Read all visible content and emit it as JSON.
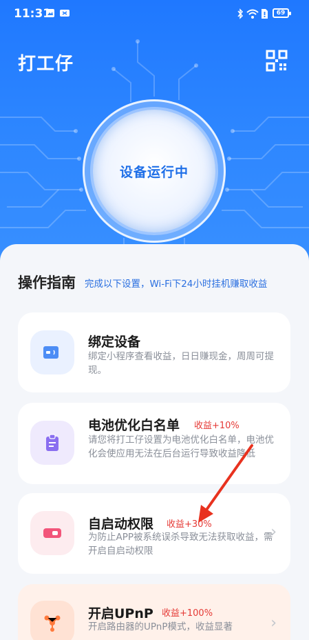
{
  "statusbar": {
    "time": "11:31",
    "battery": "69"
  },
  "header": {
    "title": "打工仔"
  },
  "hero": {
    "status_label": "设备运行中"
  },
  "guide": {
    "title": "操作指南",
    "subtitle": "完成以下设置，Wi-Fi下24小时挂机赚取收益"
  },
  "cards": [
    {
      "title": "绑定设备",
      "badge": "",
      "desc": "绑定小程序查看收益，日日赚现金，周周可提现。",
      "icon": "card-icon"
    },
    {
      "title": "电池优化白名单",
      "badge": "收益+10%",
      "desc": "请您将打工仔设置为电池优化白名单，电池优化会使应用无法在后台运行导致收益降低",
      "icon": "clipboard-icon"
    },
    {
      "title": "自启动权限",
      "badge": "收益+30%",
      "desc": "为防止APP被系统误杀导致无法获取收益，需开启自启动权限",
      "icon": "toggle-icon"
    },
    {
      "title": "开启UPnP",
      "badge": "收益+100%",
      "desc": "开启路由器的UPnP模式，收益显著",
      "icon": "network-icon"
    }
  ],
  "colors": {
    "primary": "#1f78ff",
    "badge": "#e53935",
    "annotation_arrow": "#e8321f"
  }
}
